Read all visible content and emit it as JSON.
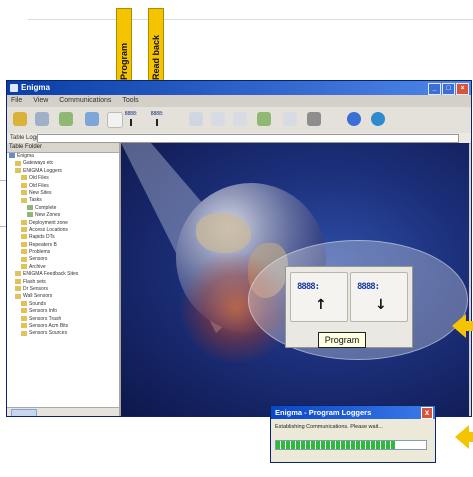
{
  "annotations": {
    "program_tag": "Program",
    "readback_tag": "Read back"
  },
  "window": {
    "title": "Enigma",
    "menu": [
      "File",
      "View",
      "Communications",
      "Tools"
    ],
    "address_label": "Table Loggers",
    "tree_header": "Table Folder",
    "tree_items": [
      {
        "label": "Enigma",
        "indent": 0
      },
      {
        "label": "Gateways etc",
        "indent": 1
      },
      {
        "label": "ENIGMA Loggers",
        "indent": 1
      },
      {
        "label": "Old Files",
        "indent": 2
      },
      {
        "label": "Old Files",
        "indent": 2
      },
      {
        "label": "New Sites",
        "indent": 2
      },
      {
        "label": "Tasks",
        "indent": 2
      },
      {
        "label": "Complete",
        "indent": 3
      },
      {
        "label": "New Zones",
        "indent": 3
      },
      {
        "label": "Deployment zone",
        "indent": 2
      },
      {
        "label": "Access Locations",
        "indent": 2
      },
      {
        "label": "Rapids DTs",
        "indent": 2
      },
      {
        "label": "Repeaters B",
        "indent": 2
      },
      {
        "label": "Problems",
        "indent": 2
      },
      {
        "label": "Sensors",
        "indent": 2
      },
      {
        "label": "Archive",
        "indent": 2
      },
      {
        "label": "ENIGMA Feedback Sites",
        "indent": 1
      },
      {
        "label": "Flash sets",
        "indent": 1
      },
      {
        "label": "Dr Sensors",
        "indent": 1
      },
      {
        "label": "Wall Sensors",
        "indent": 1
      },
      {
        "label": "Sounds",
        "indent": 2
      },
      {
        "label": "Sensors Info",
        "indent": 2
      },
      {
        "label": "Sensors Trash",
        "indent": 2
      },
      {
        "label": "Sensors Acm Bits",
        "indent": 2
      },
      {
        "label": "Sensors Sources",
        "indent": 2
      }
    ]
  },
  "callout": {
    "program_button_label": "8888:",
    "readback_button_label": "8888:",
    "tooltip": "Program"
  },
  "dialog": {
    "title": "Enigma - Program Loggers",
    "close_glyph": "x",
    "message": "Establishing Communications. Please wait...",
    "progress": 0.8
  },
  "colors": {
    "tag_yellow": "#f5c400",
    "title_blue": "#0a3ea8",
    "view_blue": "#1c2f7a",
    "progress_green": "#2fbb3a"
  }
}
